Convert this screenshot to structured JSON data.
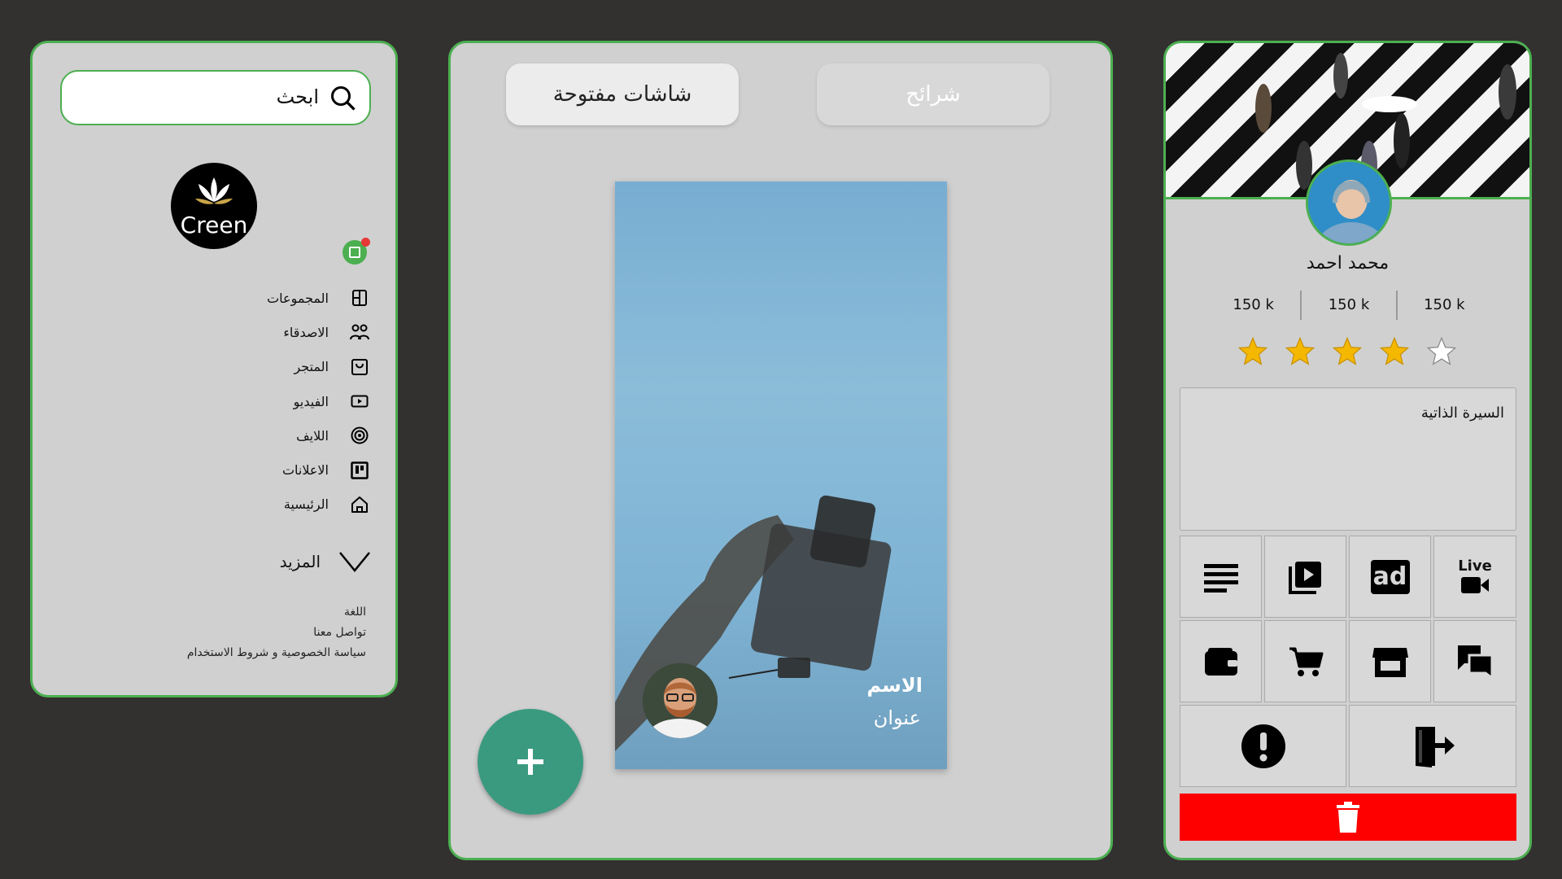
{
  "sidebar": {
    "search_placeholder": "ابحث",
    "logo_text": "Creen",
    "nav": [
      {
        "label": "المجموعات",
        "icon": "groups-icon"
      },
      {
        "label": "الاصدقاء",
        "icon": "friends-icon"
      },
      {
        "label": "المتجر",
        "icon": "store-icon"
      },
      {
        "label": "الفيديو",
        "icon": "video-icon"
      },
      {
        "label": "اللايف",
        "icon": "live-icon"
      },
      {
        "label": "الاعلانات",
        "icon": "ads-icon"
      },
      {
        "label": "الرئيسية",
        "icon": "home-icon"
      }
    ],
    "more_label": "المزيد",
    "footer": {
      "language": "اللغة",
      "contact": "تواصل معنا",
      "privacy": "سياسة الخصوصية و شروط الاستخدام"
    }
  },
  "main": {
    "tabs": {
      "open_chats": "شاشات مفتوحة",
      "slides": "شرائح"
    },
    "story": {
      "name": "الاسم",
      "subtitle": "عنوان"
    },
    "fab_icon": "plus-icon"
  },
  "profile": {
    "name": "محمد احمد",
    "stats": [
      "150 k",
      "150 k",
      "150 k"
    ],
    "rating": {
      "value": 4,
      "max": 5
    },
    "bio_label": "السيرة الذاتية",
    "live_label": "Live",
    "ad_label": "ad",
    "actions": [
      "posts-icon",
      "video-library-icon",
      "ad-icon",
      "live-video-icon",
      "wallet-icon",
      "cart-icon",
      "storefront-icon",
      "chat-icon",
      "report-icon",
      "logout-icon"
    ],
    "delete_icon": "trash-icon"
  },
  "colors": {
    "accent": "#4caf50",
    "fab": "#3a9a80",
    "delete": "#ff0000",
    "star": "#f5b800",
    "background": "#333030",
    "panel": "#d0d0d0"
  }
}
